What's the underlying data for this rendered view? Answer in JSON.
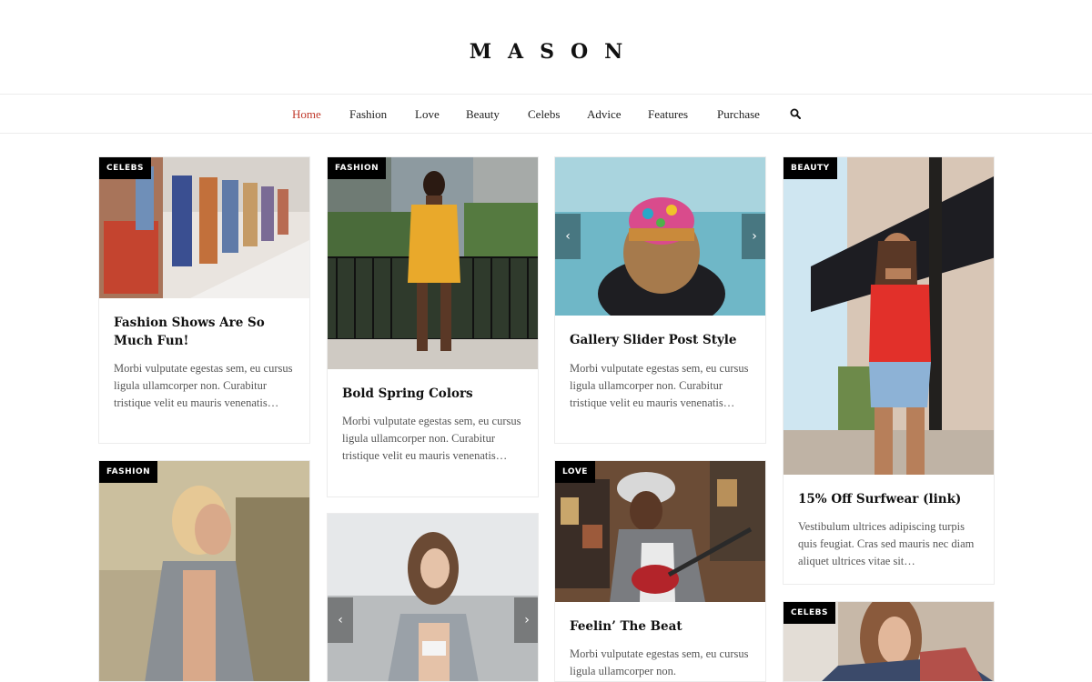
{
  "site": {
    "title": "MASON"
  },
  "nav": {
    "items": [
      {
        "label": "Home"
      },
      {
        "label": "Fashion"
      },
      {
        "label": "Love"
      },
      {
        "label": "Beauty"
      },
      {
        "label": "Celebs"
      },
      {
        "label": "Advice"
      },
      {
        "label": "Features"
      },
      {
        "label": "Purchase"
      }
    ],
    "search_icon": "search-icon",
    "active_color": "#c0392b"
  },
  "posts": {
    "p1": {
      "category": "CELEBS",
      "title": "Fashion Shows Are So Much Fun!",
      "excerpt": "Morbi vulputate egestas sem, eu cursus ligula ullamcorper non. Curabitur tristique velit eu mauris venenatis…"
    },
    "p2": {
      "category": "FASHION",
      "title": "Bold Spring Colors",
      "excerpt": "Morbi vulputate egestas sem, eu cursus ligula ullamcorper non. Curabitur tristique velit eu mauris venenatis…"
    },
    "p3": {
      "category": "",
      "title": "Gallery Slider Post Style",
      "excerpt": "Morbi vulputate egestas sem, eu cursus ligula ullamcorper non. Curabitur tristique velit eu mauris venenatis…"
    },
    "p4": {
      "category": "BEAUTY",
      "title": "15% Off Surfwear (link)",
      "excerpt": "Vestibulum ultrices adipiscing turpis quis feugiat. Cras sed mauris nec diam aliquet ultrices vitae sit…"
    },
    "p5": {
      "category": "FASHION"
    },
    "p6": {
      "category": ""
    },
    "p7": {
      "category": "LOVE",
      "title": "Feelin’ The Beat",
      "excerpt": "Morbi vulputate egestas sem, eu cursus ligula ullamcorper non."
    },
    "p8": {
      "category": "CELEBS"
    }
  },
  "slider": {
    "prev": "‹",
    "next": "›"
  }
}
